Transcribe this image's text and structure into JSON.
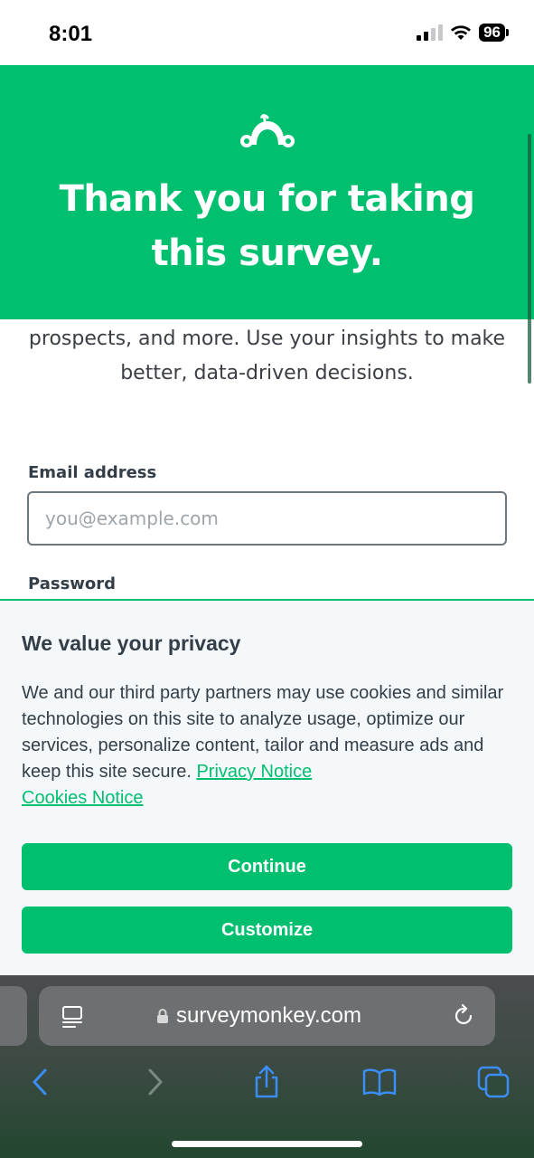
{
  "status_bar": {
    "time": "8:01",
    "battery": "96",
    "icons": [
      "signal-icon",
      "wifi-icon",
      "battery-icon"
    ]
  },
  "hero": {
    "title": "Thank you for taking this survey.",
    "logo_icon": "surveymonkey-logo-icon",
    "background_color": "#00bf6f"
  },
  "intro": {
    "text": "prospects, and more. Use your insights to make better, data-driven decisions."
  },
  "form": {
    "email_label": "Email address",
    "email_placeholder": "you@example.com",
    "email_value": "",
    "password_label": "Password"
  },
  "privacy": {
    "title": "We value your privacy",
    "body": "We and our third party partners may use cookies and similar technologies on this site to analyze usage, optimize our services, personalize content, tailor and measure ads and keep this site secure.",
    "privacy_link": "Privacy Notice",
    "cookies_link": "Cookies Notice",
    "continue_label": "Continue",
    "customize_label": "Customize",
    "accent_color": "#00bf6f"
  },
  "browser": {
    "url": "surveymonkey.com",
    "toolbar_icons": [
      "back-icon",
      "forward-icon",
      "share-icon",
      "bookmarks-icon",
      "tabs-icon"
    ]
  }
}
